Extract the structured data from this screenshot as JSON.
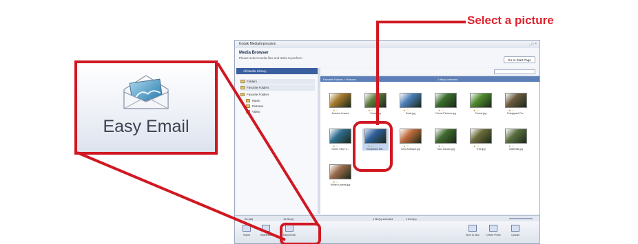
{
  "annotation": {
    "select_label": "Select a picture",
    "callout_label": "Easy Email",
    "accent_color": "#d01822"
  },
  "window": {
    "title": "Kodak MediaImpression",
    "window_buttons": "_ □ ×",
    "header_title": "Media Browser",
    "header_subtitle": "Please select media files and tasks to perform",
    "start_page_button": "Go to Start Page"
  },
  "left_panel": {
    "library_header": "All Media Library",
    "items": [
      {
        "label": "Folders",
        "icon": "folder-icon"
      },
      {
        "label": "Favorite Folders",
        "icon": "folder-icon"
      },
      {
        "label": "Favorite Folders",
        "icon": "folder-icon"
      },
      {
        "label": "Music",
        "icon": "folder-icon"
      },
      {
        "label": "Pictures",
        "icon": "folder-icon"
      },
      {
        "label": "Video",
        "icon": "folder-icon"
      }
    ]
  },
  "path_bar": {
    "location": "Favorite Folders > Pictures",
    "selection": "1 file(s) selected"
  },
  "thumbnails": [
    {
      "caption": "Autumn Leaves",
      "stars": "★ ☆",
      "color": "#a5792d"
    },
    {
      "caption": "Creek.jpg",
      "stars": "★ ☆",
      "color": "#5c7a3b"
    },
    {
      "caption": "Dock.jpg",
      "stars": "★ ☆",
      "color": "#4b7fb8"
    },
    {
      "caption": "Forest Flowers.jpg",
      "stars": "★ ☆",
      "color": "#3a6e2c"
    },
    {
      "caption": "Forest.jpg",
      "stars": "★ ☆",
      "color": "#4f8a2d"
    },
    {
      "caption": "Frangipani Flo...",
      "stars": "★ ☆",
      "color": "#6b5a3d"
    },
    {
      "caption": "Green Sea Tu...",
      "stars": "★ ☆",
      "color": "#2f6e8e"
    },
    {
      "caption": "Humpback Wh...",
      "stars": "★ ☆",
      "color": "#2e5f99"
    },
    {
      "caption": "Oryx Antelope.jpg",
      "stars": "★ ☆",
      "color": "#c06a3a"
    },
    {
      "caption": "Toco Toucan.jpg",
      "stars": "★ ☆",
      "color": "#3f6a2e"
    },
    {
      "caption": "Tree.jpg",
      "stars": "★ ☆",
      "color": "#6b6a3a"
    },
    {
      "caption": "Waterfall.jpg",
      "stars": "★ ☆",
      "color": "#5a6e3f"
    },
    {
      "caption": "Winter Leaves.jpg",
      "stars": "★ ☆",
      "color": "#9a6b4a"
    }
  ],
  "selected_thumbnail": 7,
  "status": {
    "left": "All (all)",
    "count": "13 file(s)",
    "selected": "1 file(s) selected",
    "items": "1 item(s)"
  },
  "bottom_tools": [
    {
      "label": "Import",
      "icon": "import-icon"
    },
    {
      "label": "Slideshow",
      "icon": "slideshow-icon"
    },
    {
      "label": "Easy Email",
      "icon": "email-icon"
    },
    {
      "label": "Burn to Disc",
      "icon": "disc-icon"
    },
    {
      "label": "Create Photo",
      "icon": "photo-icon"
    },
    {
      "label": "Upload",
      "icon": "upload-icon"
    }
  ]
}
